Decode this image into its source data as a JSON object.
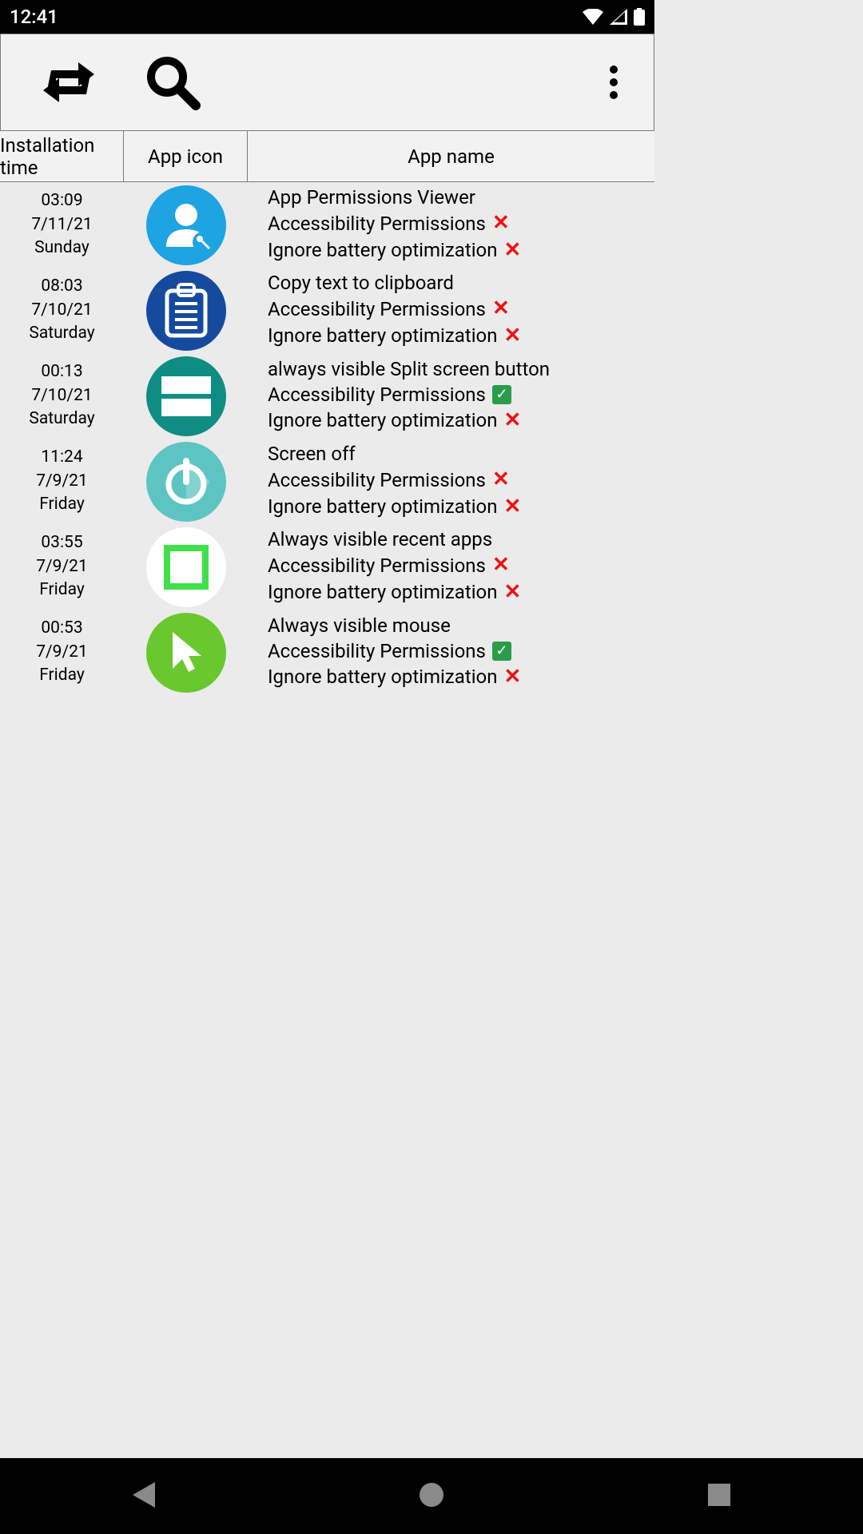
{
  "status": {
    "time": "12:41"
  },
  "header": {
    "col1": "Installation time",
    "col2": "App icon",
    "col3": "App name"
  },
  "perm_labels": {
    "accessibility": "Accessibility Permissions",
    "battery": "Ignore battery optimization"
  },
  "apps": [
    {
      "time": "03:09",
      "date": "7/11/21",
      "day": "Sunday",
      "name": "App Permissions Viewer",
      "access": false,
      "battery": false,
      "icon_bg": "#1ea3e3",
      "icon_type": "user-key"
    },
    {
      "time": "08:03",
      "date": "7/10/21",
      "day": "Saturday",
      "name": "Copy text to clipboard",
      "access": false,
      "battery": false,
      "icon_bg": "#164a9e",
      "icon_type": "clipboard"
    },
    {
      "time": "00:13",
      "date": "7/10/21",
      "day": "Saturday",
      "name": "always visible Split screen button",
      "access": true,
      "battery": false,
      "icon_bg": "#0f8d83",
      "icon_type": "split"
    },
    {
      "time": "11:24",
      "date": "7/9/21",
      "day": "Friday",
      "name": "Screen off",
      "access": false,
      "battery": false,
      "icon_bg": "#5cc5c1",
      "icon_type": "power"
    },
    {
      "time": "03:55",
      "date": "7/9/21",
      "day": "Friday",
      "name": "Always visible recent apps",
      "access": false,
      "battery": false,
      "icon_bg": "#ffffff",
      "icon_type": "square"
    },
    {
      "time": "00:53",
      "date": "7/9/21",
      "day": "Friday",
      "name": "Always visible mouse",
      "access": true,
      "battery": false,
      "icon_bg": "#68c82d",
      "icon_type": "cursor"
    }
  ]
}
